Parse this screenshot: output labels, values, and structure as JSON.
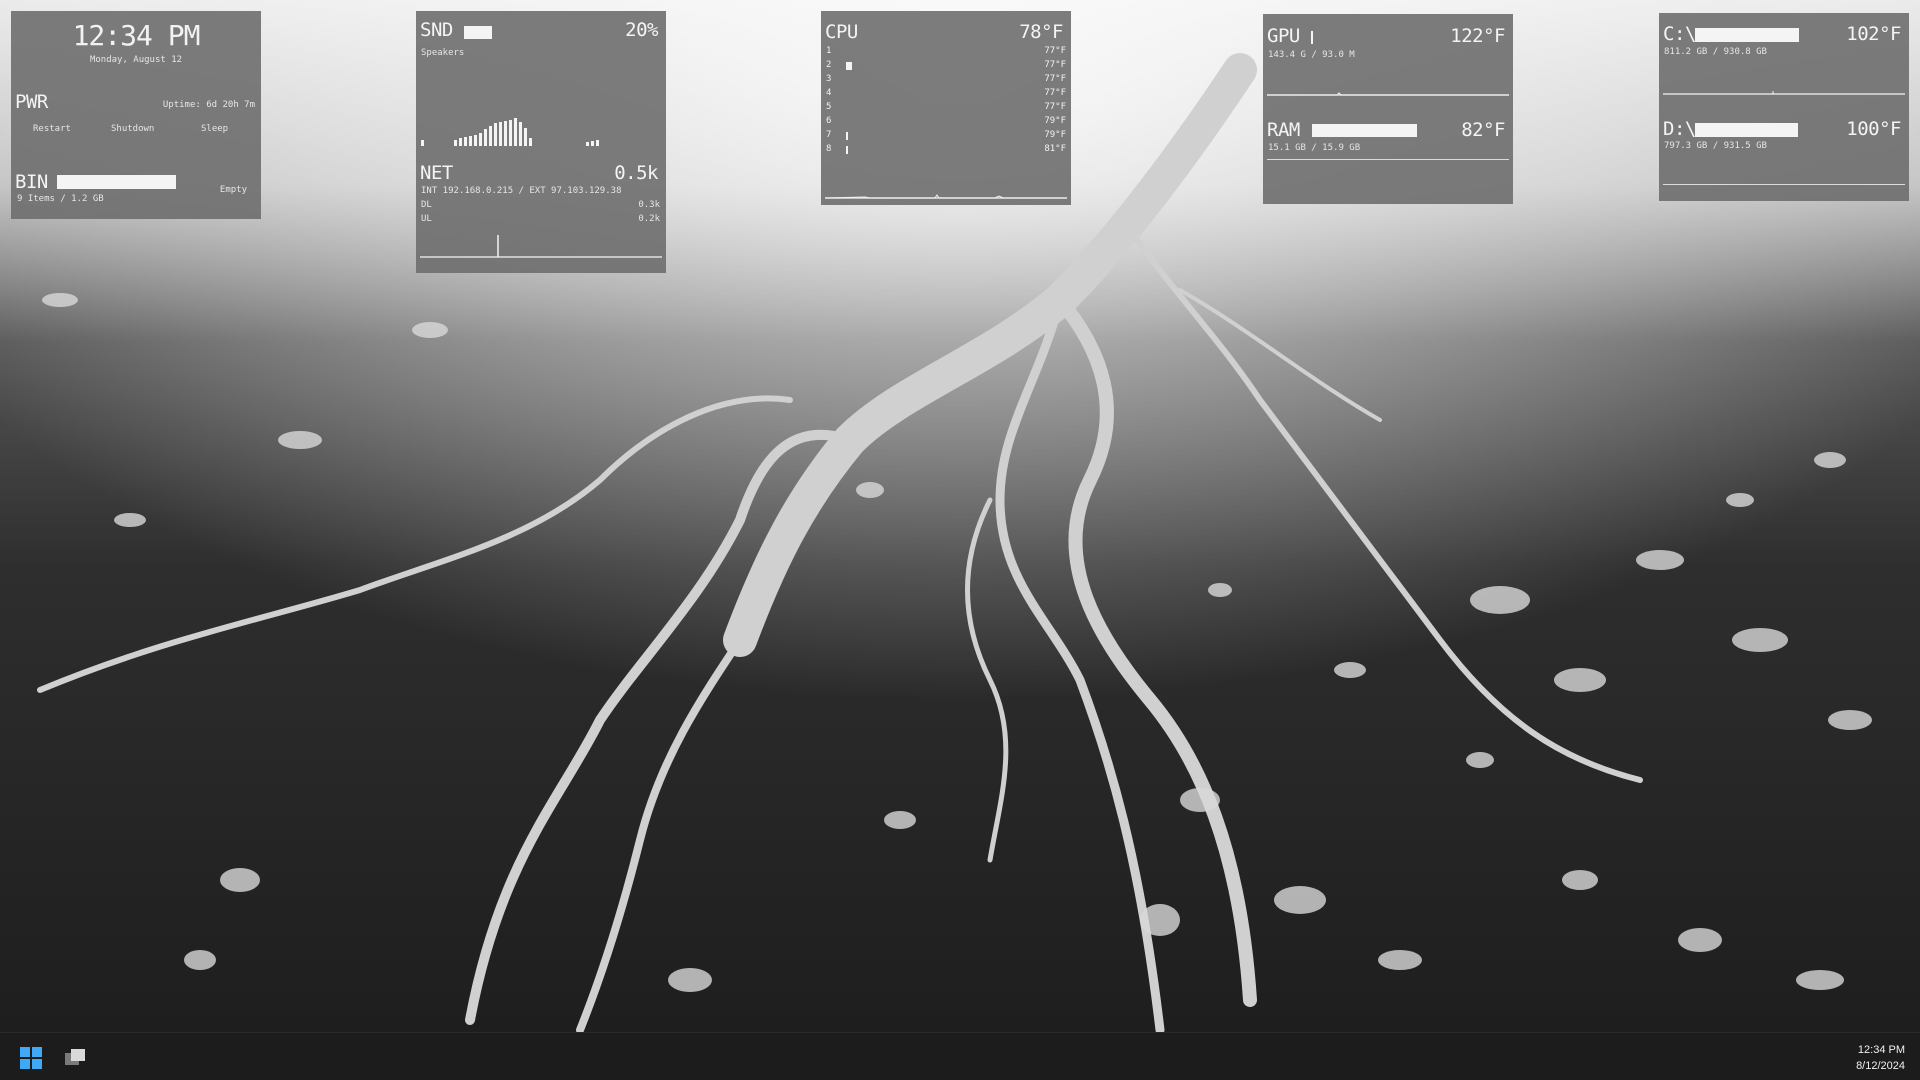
{
  "clock": {
    "time": "12:34 PM",
    "date": "Monday, August 12"
  },
  "power": {
    "title": "PWR",
    "uptime": "Uptime: 6d 20h 7m",
    "restart": "Restart",
    "shutdown": "Shutdown",
    "sleep": "Sleep"
  },
  "bin": {
    "title": "BIN",
    "status": "Empty",
    "info": "9 Items / 1.2 GB",
    "fill": 0.86
  },
  "sound": {
    "title": "SND",
    "percent": "20%",
    "device": "Speakers",
    "level": 0.2
  },
  "net": {
    "title": "NET",
    "rate": "0.5k",
    "addresses": "INT 192.168.0.215 / EXT 97.103.129.38",
    "dl_label": "DL",
    "dl_value": "0.3k",
    "ul_label": "UL",
    "ul_value": "0.2k"
  },
  "cpu": {
    "title": "CPU",
    "temp": "78°F",
    "cores": [
      {
        "id": "1",
        "temp": "77°F",
        "load": 0
      },
      {
        "id": "2",
        "temp": "77°F",
        "load": 0.05
      },
      {
        "id": "3",
        "temp": "77°F",
        "load": 0
      },
      {
        "id": "4",
        "temp": "77°F",
        "load": 0
      },
      {
        "id": "5",
        "temp": "77°F",
        "load": 0
      },
      {
        "id": "6",
        "temp": "79°F",
        "load": 0
      },
      {
        "id": "7",
        "temp": "79°F",
        "load": 0.01
      },
      {
        "id": "8",
        "temp": "81°F",
        "load": 0.01
      }
    ]
  },
  "gpu": {
    "title": "GPU",
    "temp": "122°F",
    "memory": "143.4 G / 93.0 M",
    "load": 0.01
  },
  "ram": {
    "title": "RAM",
    "temp": "82°F",
    "usage": "15.1 GB / 15.9 GB",
    "fill": 0.95
  },
  "drive_c": {
    "title": "C:\\",
    "temp": "102°F",
    "usage": "811.2 GB / 930.8 GB",
    "fill": 0.87
  },
  "drive_d": {
    "title": "D:\\",
    "temp": "100°F",
    "usage": "797.3 GB / 931.5 GB",
    "fill": 0.86
  },
  "taskbar": {
    "time": "12:34 PM",
    "date": "8/12/2024"
  },
  "icons": {
    "start": "windows-start-icon",
    "taskview": "task-view-icon"
  },
  "colors": {
    "widget_bg": "#6e6e6e",
    "accent": "#3fa9f5",
    "taskbar_bg": "#1c1c1c"
  }
}
